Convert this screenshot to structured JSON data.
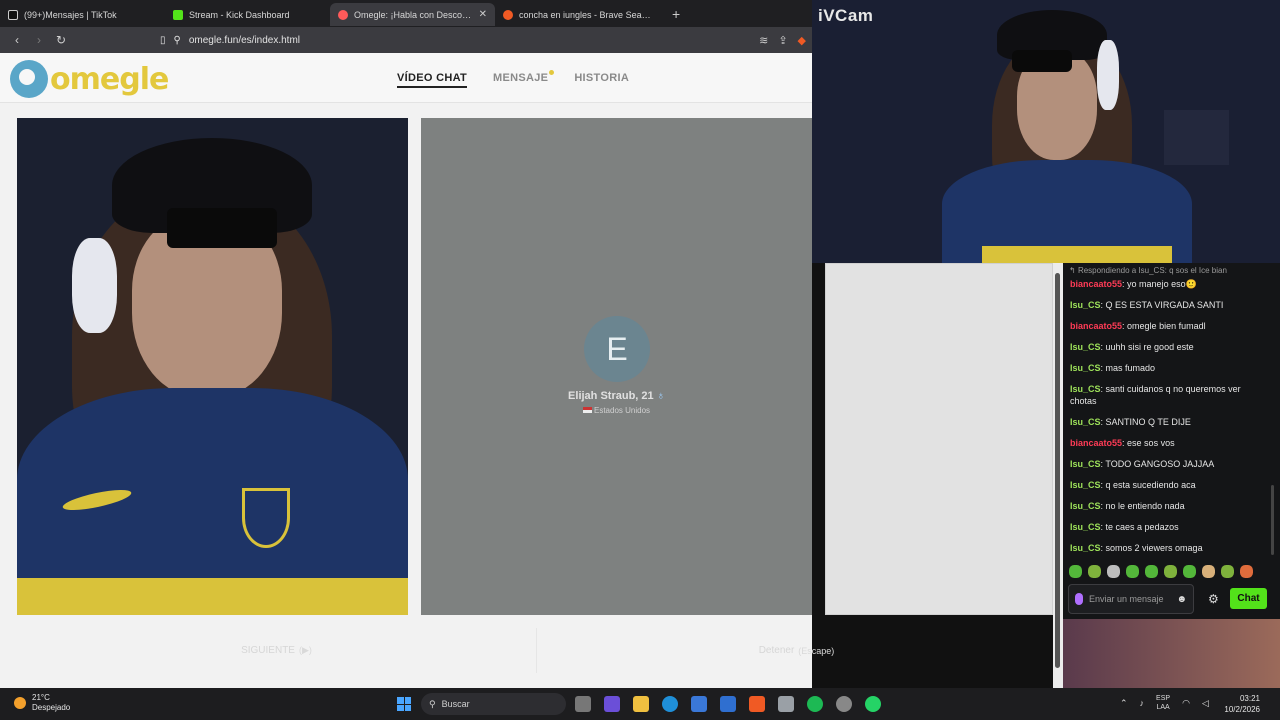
{
  "browser": {
    "tabs": [
      {
        "title": "(99+)Mensajes | TikTok",
        "favicon": "tiktok-icon",
        "active": false
      },
      {
        "title": "Stream - Kick Dashboard",
        "favicon": "kick-icon",
        "active": false
      },
      {
        "title": "Omegle: ¡Habla con Desconocidos!",
        "favicon": "omegle-icon",
        "active": true
      },
      {
        "title": "concha en iungles - Brave Search",
        "favicon": "brave-icon",
        "active": false
      }
    ],
    "new_tab": "+",
    "url": "omegle.fun/es/index.html"
  },
  "omegle": {
    "logo_text": "omegle",
    "nav": {
      "video_chat": "VÍDEO CHAT",
      "message": "MENSAJE",
      "history": "HISTORIA"
    },
    "peer": {
      "initial": "E",
      "name": "Elijah Straub, 21",
      "country": "Estados Unidos"
    },
    "buttons": {
      "next": "SIGUIENTE",
      "next_key": "(▶)",
      "stop": "Detener",
      "stop_key": "(Escape)"
    }
  },
  "webcam": {
    "title": "iVCam"
  },
  "chat": {
    "reply_to": "Respondiendo a Isu_CS: q sos el Ice bian",
    "messages": [
      {
        "user": "biancaato55",
        "color": "red",
        "text": "yo manejo eso🙂"
      },
      {
        "user": "Isu_CS",
        "color": "green",
        "text": "Q ES ESTA VIRGADA SANTI"
      },
      {
        "user": "biancaato55",
        "color": "red",
        "text": "omegle bien fumadl"
      },
      {
        "user": "Isu_CS",
        "color": "green",
        "text": "uuhh sisi re good este"
      },
      {
        "user": "Isu_CS",
        "color": "green",
        "text": "mas fumado"
      },
      {
        "user": "Isu_CS",
        "color": "green",
        "text": "santi cuidanos q no queremos ver chotas"
      },
      {
        "user": "Isu_CS",
        "color": "green",
        "text": "SANTINO Q TE DIJE"
      },
      {
        "user": "biancaato55",
        "color": "red",
        "text": "ese sos vos"
      },
      {
        "user": "Isu_CS",
        "color": "green",
        "text": "TODO GANGOSO JAJJAA"
      },
      {
        "user": "Isu_CS",
        "color": "green",
        "text": "q esta sucediendo aca"
      },
      {
        "user": "Isu_CS",
        "color": "green",
        "text": "no le entiendo nada"
      },
      {
        "user": "Isu_CS",
        "color": "green",
        "text": "te caes a pedazos"
      },
      {
        "user": "Isu_CS",
        "color": "green",
        "text": "somos 2 viewers omaga"
      }
    ],
    "input_placeholder": "Enviar un mensaje",
    "send_label": "Chat"
  },
  "taskbar": {
    "weather_temp": "21°C",
    "weather_desc": "Despejado",
    "search_label": "Buscar",
    "lang_top": "ESP",
    "lang_bottom": "LAA",
    "time": "03:21",
    "date": "10/2/2026"
  },
  "colors": {
    "kick_green": "#53e21a",
    "omegle_yellow": "#e3c83d",
    "omegle_blue": "#5aa6c8",
    "user_green": "#9ee25a",
    "user_red": "#ff3b56"
  }
}
